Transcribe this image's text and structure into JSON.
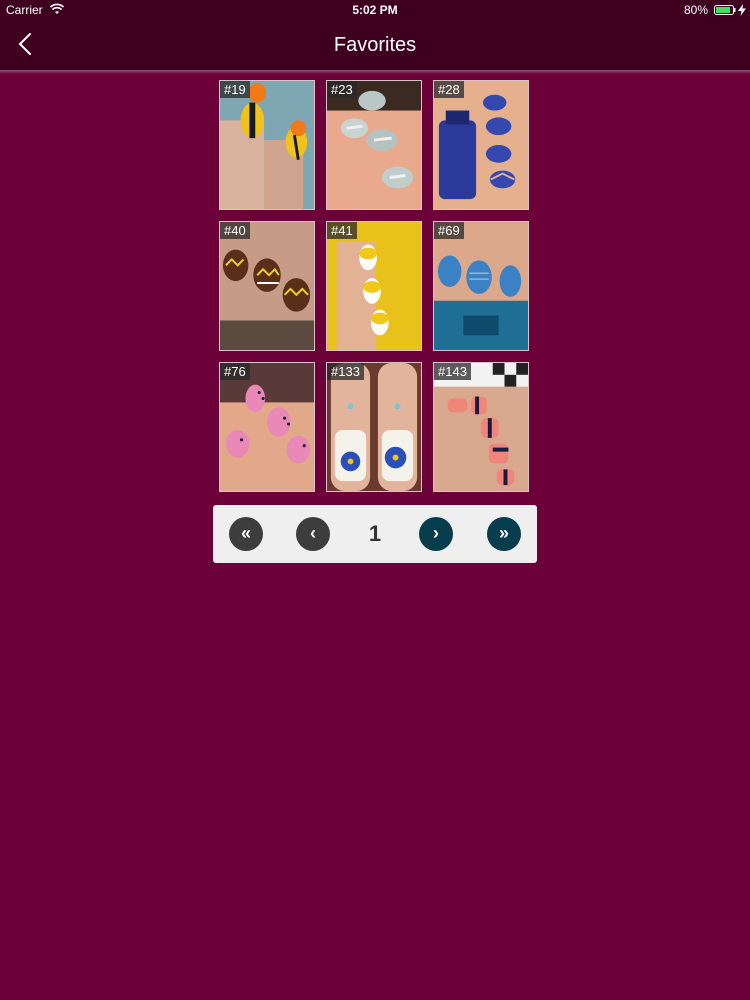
{
  "status_bar": {
    "carrier": "Carrier",
    "time": "5:02 PM",
    "battery": "80%"
  },
  "nav": {
    "title": "Favorites",
    "back_icon": "chevron-left-icon"
  },
  "favorites": [
    {
      "label": "#19"
    },
    {
      "label": "#23"
    },
    {
      "label": "#28"
    },
    {
      "label": "#40"
    },
    {
      "label": "#41"
    },
    {
      "label": "#69"
    },
    {
      "label": "#76"
    },
    {
      "label": "#133"
    },
    {
      "label": "#143"
    }
  ],
  "pager": {
    "first": "«",
    "prev": "‹",
    "page": "1",
    "next": "›",
    "last": "»"
  },
  "colors": {
    "background": "#6c0038",
    "nav_background": "#3f0020",
    "pager_disabled": "#3d3d3d",
    "pager_active": "#073d4c"
  }
}
